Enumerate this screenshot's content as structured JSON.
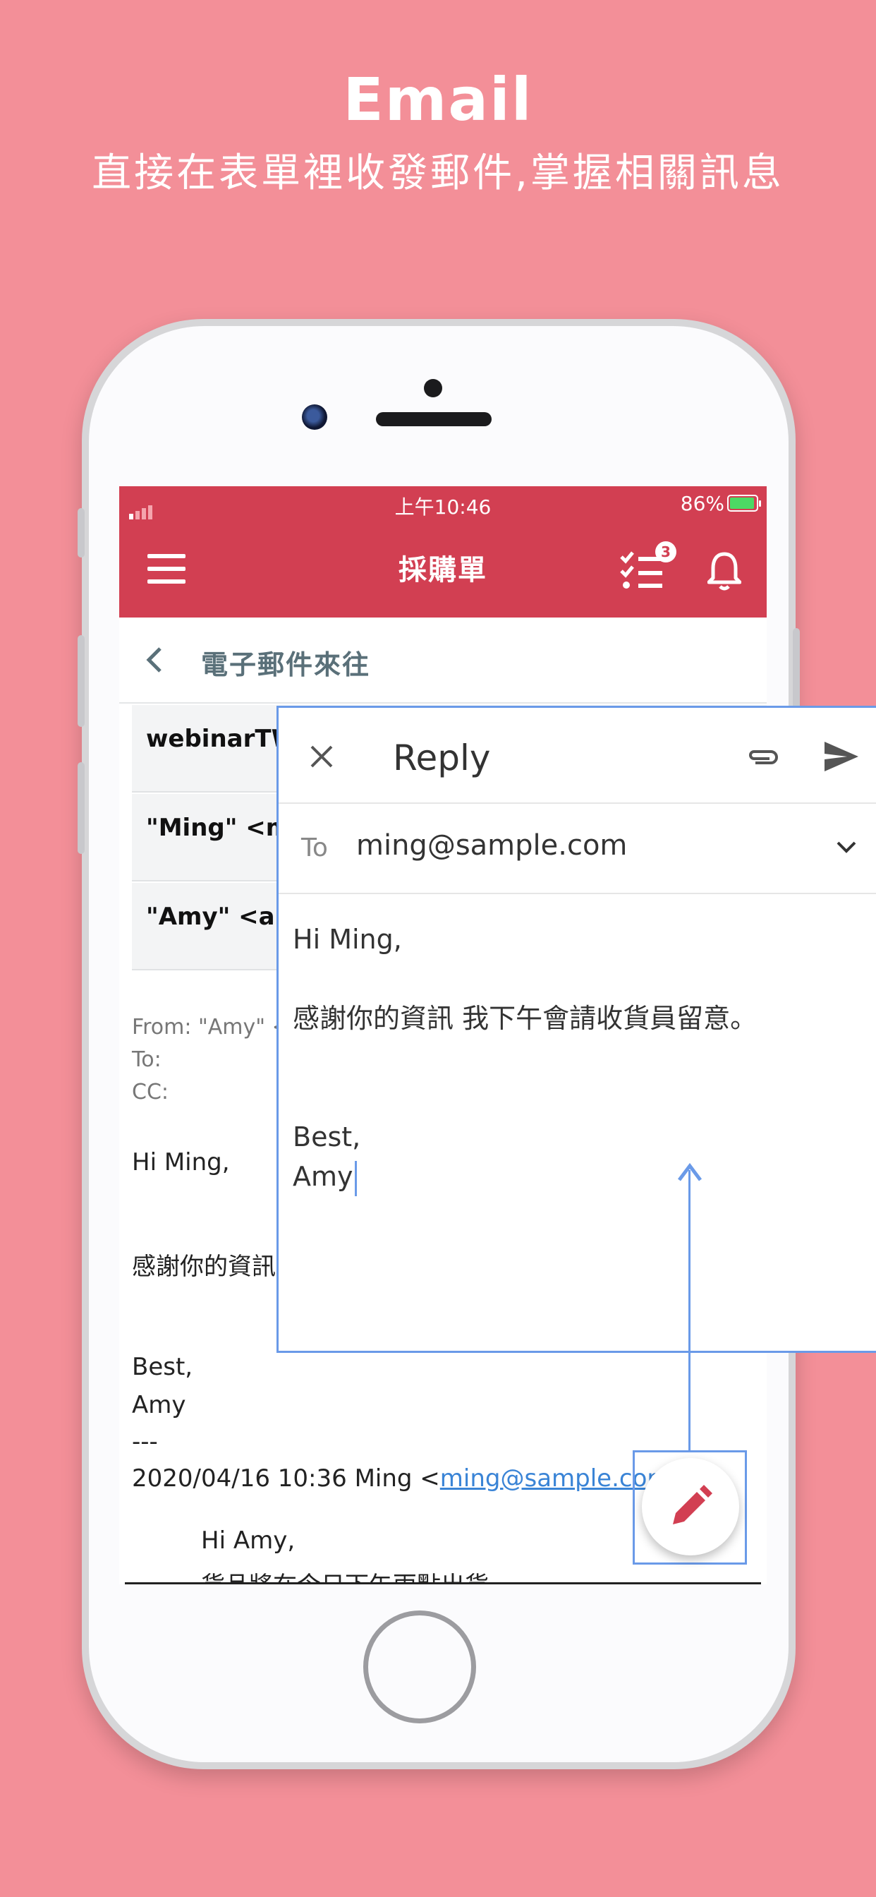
{
  "hero": {
    "title": "Email",
    "subtitle": "直接在表單裡收發郵件,掌握相關訊息"
  },
  "status_bar": {
    "time": "上午10:46",
    "battery": "86%"
  },
  "app_bar": {
    "title": "採購單",
    "task_badge": "3"
  },
  "subheader": {
    "title": "電子郵件來往"
  },
  "threads": [
    "webinarTW.",
    "\"Ming\" <min",
    "\"Amy\" <amy"
  ],
  "message": {
    "from": "From: \"Amy\" <",
    "to": "To:",
    "cc": "CC:",
    "greeting": "Hi Ming,",
    "line1": "感謝你的資訊",
    "signoff": "Best,",
    "name": "Amy",
    "separator": "---",
    "quote_header": "2020/04/16 10:36 Ming <",
    "quote_link": "ming@sample.com",
    "quote_greeting": "Hi Amy,",
    "quote_line1": "貨品將在今日下午兩點出貨。"
  },
  "reply": {
    "title": "Reply",
    "to_label": "To",
    "to_value": "ming@sample.com",
    "body_greeting": "Hi Ming,",
    "body_line": "感謝你的資訊 我下午會請收貨員留意。",
    "body_signoff": "Best,",
    "body_name": "Amy"
  },
  "colors": {
    "background": "#f38f98",
    "app_bar": "#d23f52",
    "highlight": "#6a9ae8",
    "fab_icon": "#d23f52"
  }
}
